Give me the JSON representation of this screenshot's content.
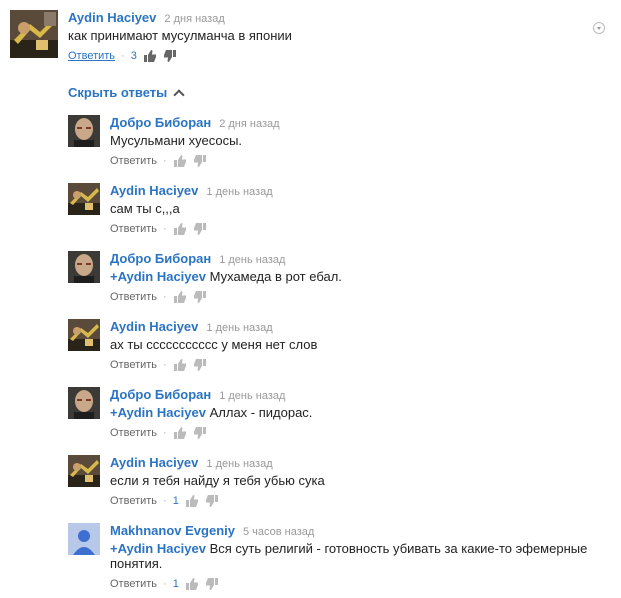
{
  "top_comment": {
    "author": "Aydin Haciyev",
    "time": "2 дня назад",
    "text": "как принимают мусулманча в японии",
    "reply_label": "Ответить",
    "like_count": "3"
  },
  "hide_replies_label": "Скрыть ответы",
  "replies": [
    {
      "author": "Добро Биборан",
      "time": "2 дня назад",
      "mention": "",
      "text": "Мусульмани хуесосы.",
      "reply_label": "Ответить",
      "like_count": "",
      "avatar": "bald"
    },
    {
      "author": "Aydin Haciyev",
      "time": "1 день назад",
      "mention": "",
      "text": "сам ты с,,,а",
      "reply_label": "Ответить",
      "like_count": "",
      "avatar": "dark"
    },
    {
      "author": "Добро Биборан",
      "time": "1 день назад",
      "mention": "+Aydin Haciyev",
      "text": "Мухамеда в рот ебал.",
      "reply_label": "Ответить",
      "like_count": "",
      "avatar": "bald"
    },
    {
      "author": "Aydin Haciyev",
      "time": "1 день назад",
      "mention": "",
      "text": "ах ты ссссссссссс у меня нет слов",
      "reply_label": "Ответить",
      "like_count": "",
      "avatar": "dark"
    },
    {
      "author": "Добро Биборан",
      "time": "1 день назад",
      "mention": "+Aydin Haciyev",
      "text": "Аллах - пидорас.",
      "reply_label": "Ответить",
      "like_count": "",
      "avatar": "bald"
    },
    {
      "author": "Aydin Haciyev",
      "time": "1 день назад",
      "mention": "",
      "text": "если я тебя найду я тебя убью сука",
      "reply_label": "Ответить",
      "like_count": "1",
      "avatar": "dark"
    },
    {
      "author": "Makhnanov Evgeniy",
      "time": "5 часов назад",
      "mention": "+Aydin Haciyev",
      "text": "Вся суть религий - готовность убивать за какие-то эфемерные понятия.",
      "reply_label": "Ответить",
      "like_count": "1",
      "avatar": "default"
    }
  ],
  "icons": {
    "like": "thumbs-up-icon",
    "dislike": "thumbs-down-icon",
    "menu": "dropdown-caret-icon",
    "collapse": "chevron-up-icon"
  },
  "colors": {
    "link": "#2b74c4",
    "time": "#999999",
    "text": "#222222"
  }
}
